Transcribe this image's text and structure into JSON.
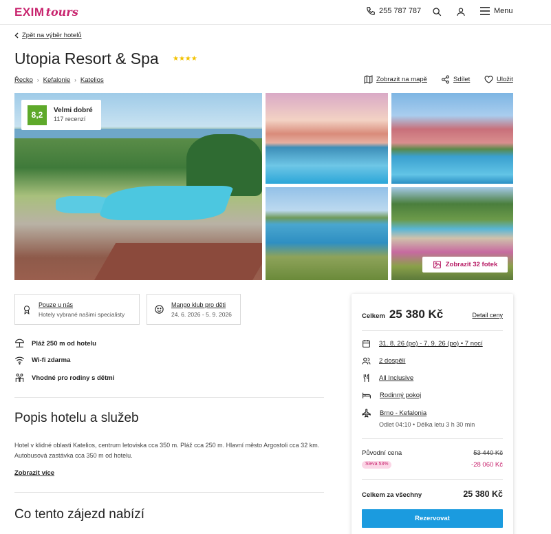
{
  "header": {
    "logo_main": "EXIM",
    "logo_sub": "tours",
    "phone": "255 787 787",
    "menu_label": "Menu"
  },
  "back_link": "Zpět na výběr hotelů",
  "hotel": {
    "name": "Utopia Resort & Spa",
    "stars": "★★★★",
    "breadcrumbs": [
      "Řecko",
      "Kefalonie",
      "Katelios"
    ],
    "actions": {
      "map": "Zobrazit na mapě",
      "share": "Sdílet",
      "save": "Uložit"
    },
    "rating": {
      "score": "8,2",
      "label": "Velmi dobré",
      "reviews": "117 recenzí"
    },
    "photos_button": "Zobrazit 32 fotek"
  },
  "features": [
    {
      "title": "Pouze u nás",
      "subtitle": "Hotely vybrané našimi specialisty"
    },
    {
      "title": "Mango klub pro děti",
      "subtitle": "24. 6. 2026 - 5. 9. 2026"
    }
  ],
  "amenities": [
    "Pláž 250 m od hotelu",
    "Wi-fi zdarma",
    "Vhodné pro rodiny s dětmi"
  ],
  "description": {
    "heading": "Popis hotelu a služeb",
    "text": "Hotel v klidné oblasti Katelios, centrum letoviska cca 350 m. Pláž cca 250 m. Hlavní město Argostoli cca 32 km. Autobusová zastávka cca 350 m od hotelu.",
    "more": "Zobrazit více"
  },
  "offer_heading": "Co tento zájezd nabízí",
  "booking": {
    "total_label": "Celkem",
    "total_value": "25 380 Kč",
    "detail_link": "Detail ceny",
    "dates": "31. 8. 26 (po) - 7. 9. 26 (po) • 7 nocí",
    "guests": "2 dospělí",
    "board": "All Inclusive",
    "room": "Rodinný pokoj",
    "flight": "Brno - Kefalonia",
    "flight_info": "Odlet 04:10 • Délka letu 3 h 30 min",
    "original_label": "Původní cena",
    "original_value": "53 440 Kč",
    "sale_badge": "Sleva 53%",
    "discount_value": "-28 060 Kč",
    "all_label": "Celkem za všechny",
    "all_value": "25 380 Kč",
    "book_button": "Rezervovat"
  },
  "colors": {
    "brand": "#c8246e",
    "rating": "#5ea92a",
    "book_button": "#1b9bdf",
    "stars": "#f2c200"
  }
}
